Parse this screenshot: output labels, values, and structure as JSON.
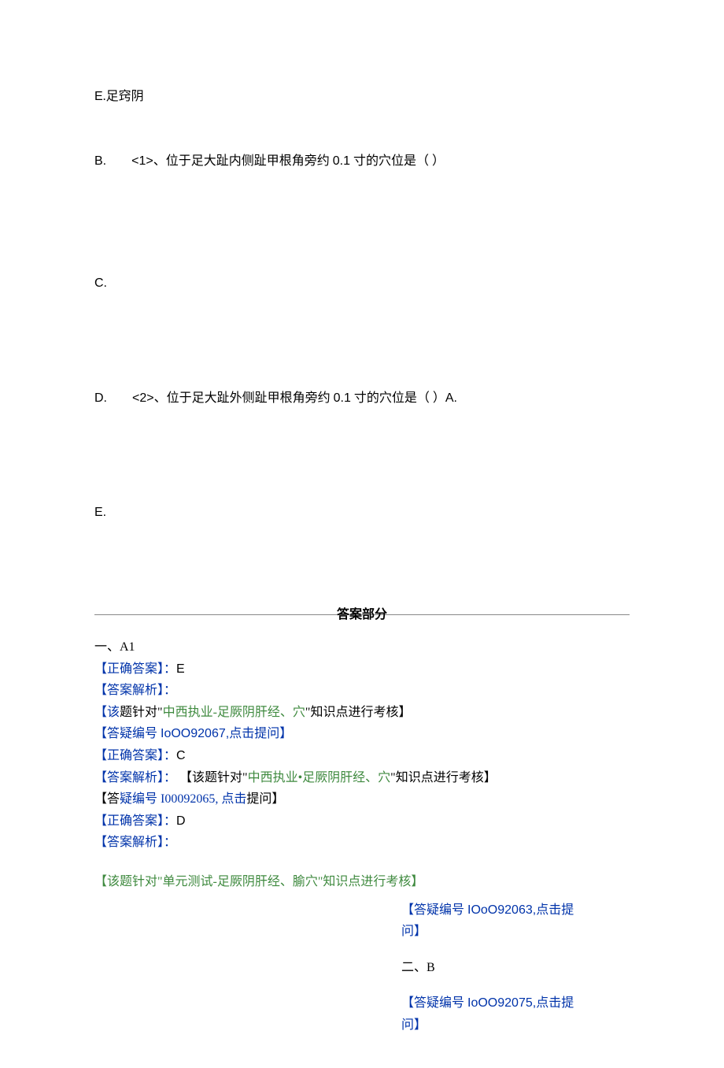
{
  "options": {
    "e_label": "E.足窍阴",
    "b_label": "B.",
    "b_sub": "<1>、位于足大趾内侧趾甲根角旁约 0.1 寸的穴位是（ ）",
    "c_label": "C.",
    "d_label": "D.",
    "d_sub": "<2>、位于足大趾外侧趾甲根角旁约 0.1 寸的穴位是（ ）A.",
    "e2_label": "E."
  },
  "answers": {
    "section_title": "答案部分",
    "a1_heading": "一、A1",
    "a1_correct_label": "【正确答案】：",
    "a1_correct_value": "E",
    "a1_exp_label": "【答案解析】：",
    "a1_note_open": "【该",
    "a1_note_mid1": "题针对\"",
    "a1_note_green1": "中西执业-足厥阴肝经、穴",
    "a1_note_end1": "\"知识点进行考核】",
    "a1_qlink_open": "【答疑编号 ",
    "a1_qlink_id1": "IoOO92067,",
    "a1_qlink_action1": "点击提问",
    "a1_qlink_close": "】",
    "a2_correct_label": "【正确答案】：",
    "a2_correct_value": "C",
    "a2_exp_label": "【答案解析】：",
    "a2_note_open": "【该题针对\"",
    "a2_note_green": "中西执业•足厥阴肝经、穴",
    "a2_note_end": "\"知识点进行考核】",
    "a2_qlink_pre": "【答",
    "a2_qlink_mid": "疑编号 I00092065, 点击",
    "a2_qlink_post": "提问】",
    "a3_correct_label": "【正确答案】：",
    "a3_correct_value": "D",
    "a3_exp_label": "【答案解析】：",
    "a3_note_full": "【该题针对\"单元测试-足厥阴肝经、腧穴\"知识点进行考核】",
    "right": {
      "q1_open": "【答疑编号 ",
      "q1_id": "IOoO92063,",
      "q1_action": "点击提",
      "q1_line2": "问】",
      "section_b": "二、B",
      "q2_open": "【答疑编号 ",
      "q2_id": "IoOO92075,",
      "q2_action": "点击提",
      "q2_line2": "问】"
    }
  }
}
